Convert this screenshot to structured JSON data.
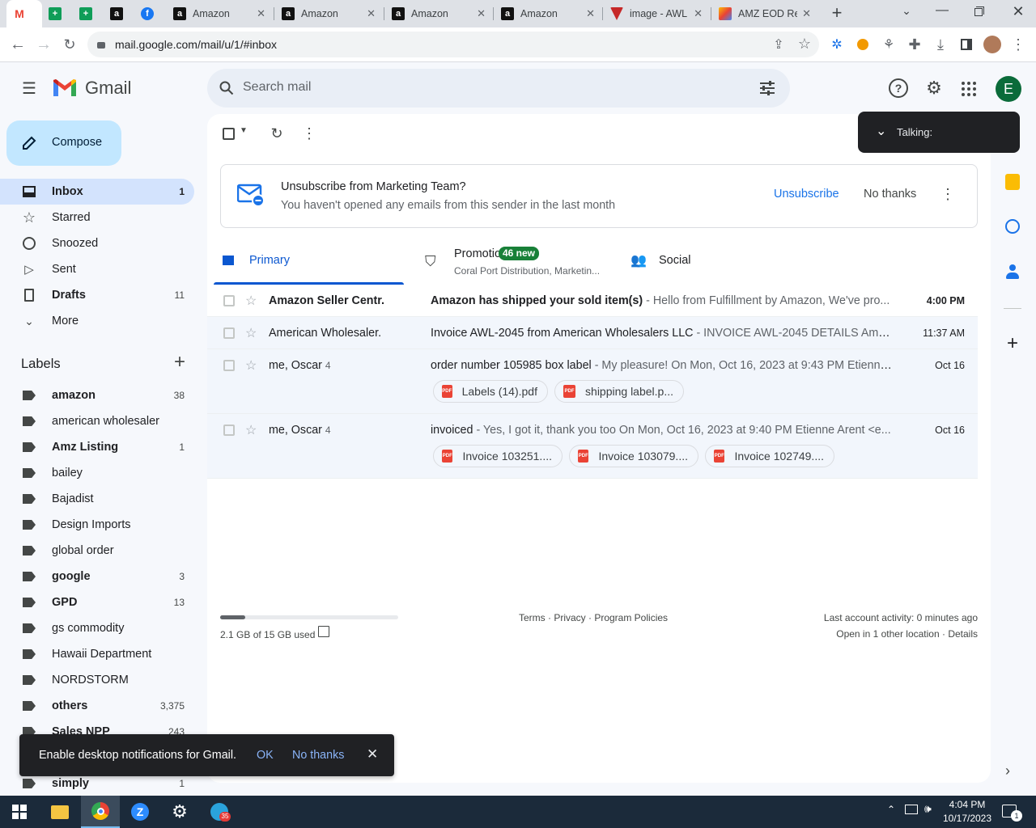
{
  "browser": {
    "tabs": [
      {
        "title": "",
        "icon": "gmail-icon"
      },
      {
        "title": "",
        "icon": "sheets-icon"
      },
      {
        "title": "",
        "icon": "sheets-icon"
      },
      {
        "title": "",
        "icon": "amazon-icon"
      },
      {
        "title": "",
        "icon": "facebook-icon"
      },
      {
        "title": "Amazon",
        "icon": "amazon-icon"
      },
      {
        "title": "Amazon",
        "icon": "amazon-icon"
      },
      {
        "title": "Amazon",
        "icon": "amazon-icon"
      },
      {
        "title": "Amazon",
        "icon": "amazon-icon"
      },
      {
        "title": "image - AWL",
        "icon": "awl-icon"
      },
      {
        "title": "AMZ EOD Re",
        "icon": "apps-script-icon"
      }
    ],
    "url": "mail.google.com/mail/u/1/#inbox"
  },
  "gmail": {
    "logo_text": "Gmail",
    "search_placeholder": "Search mail",
    "avatar_letter": "E",
    "compose_label": "Compose",
    "nav": [
      {
        "label": "Inbox",
        "count": "1",
        "icon": "inbox-icon"
      },
      {
        "label": "Starred",
        "count": "",
        "icon": "star-icon"
      },
      {
        "label": "Snoozed",
        "count": "",
        "icon": "clock-icon"
      },
      {
        "label": "Sent",
        "count": "",
        "icon": "send-icon"
      },
      {
        "label": "Drafts",
        "count": "11",
        "icon": "draft-icon"
      },
      {
        "label": "More",
        "count": "",
        "icon": "chevron-down-icon"
      }
    ],
    "labels_header": "Labels",
    "labels": [
      {
        "name": "amazon",
        "count": "38",
        "bold": true
      },
      {
        "name": "american wholesaler",
        "count": "",
        "bold": false
      },
      {
        "name": "Amz Listing",
        "count": "1",
        "bold": true
      },
      {
        "name": "bailey",
        "count": "",
        "bold": false
      },
      {
        "name": "Bajadist",
        "count": "",
        "bold": false
      },
      {
        "name": "Design Imports",
        "count": "",
        "bold": false
      },
      {
        "name": "global order",
        "count": "",
        "bold": false
      },
      {
        "name": "google",
        "count": "3",
        "bold": true
      },
      {
        "name": "GPD",
        "count": "13",
        "bold": true
      },
      {
        "name": "gs commodity",
        "count": "",
        "bold": false
      },
      {
        "name": "Hawaii Department",
        "count": "",
        "bold": false
      },
      {
        "name": "NORDSTORM",
        "count": "",
        "bold": false
      },
      {
        "name": "others",
        "count": "3,375",
        "bold": true
      },
      {
        "name": "Sales NPP",
        "count": "243",
        "bold": true
      },
      {
        "name": "",
        "count": "",
        "bold": false
      },
      {
        "name": "simply",
        "count": "1",
        "bold": true
      }
    ],
    "banner": {
      "title": "Unsubscribe from Marketing Team?",
      "subtitle": "You haven't opened any emails from this sender in the last month",
      "unsubscribe": "Unsubscribe",
      "no_thanks": "No thanks"
    },
    "tabs": {
      "primary": "Primary",
      "promotions": "Promotions",
      "promotions_badge": "46 new",
      "promotions_sub": "Coral Port Distribution, Marketin...",
      "social": "Social"
    },
    "emails": [
      {
        "sender": "Amazon Seller Centr.",
        "count": "",
        "subject": "Amazon has shipped your sold item(s)",
        "snippet": " - Hello from Fulfillment by Amazon, We've pro...",
        "date": "4:00 PM",
        "unread": true,
        "attachments": []
      },
      {
        "sender": "American Wholesaler.",
        "count": "",
        "subject": "Invoice AWL-2045 from American Wholesalers LLC",
        "snippet": " - INVOICE AWL-2045 DETAILS Amer...",
        "date": "11:37 AM",
        "unread": false,
        "attachments": []
      },
      {
        "sender": "me, Oscar",
        "count": "4",
        "subject": "order number 105985 box label",
        "snippet": " - My pleasure! On Mon, Oct 16, 2023 at 9:43 PM Etienne...",
        "date": "Oct 16",
        "unread": false,
        "attachments": [
          "Labels (14).pdf",
          "shipping label.p..."
        ]
      },
      {
        "sender": "me, Oscar",
        "count": "4",
        "subject": "invoiced",
        "snippet": " - Yes, I got it, thank you too On Mon, Oct 16, 2023 at 9:40 PM Etienne Arent <e...",
        "date": "Oct 16",
        "unread": false,
        "attachments": [
          "Invoice 103251....",
          "Invoice 103079....",
          "Invoice 102749...."
        ]
      }
    ],
    "storage": {
      "text": "2.1 GB of 15 GB used",
      "used_fraction": 0.14
    },
    "footer_links": "Terms · Privacy · Program Policies",
    "activity": "Last account activity: 0 minutes ago",
    "other_location": "Open in 1 other location · Details",
    "talking": "Talking:",
    "notification": {
      "text": "Enable desktop notifications for Gmail.",
      "ok": "OK",
      "no_thanks": "No thanks"
    }
  },
  "taskbar": {
    "time": "4:04 PM",
    "date": "10/17/2023",
    "telegram_badge": "35",
    "notification_count": "1"
  }
}
